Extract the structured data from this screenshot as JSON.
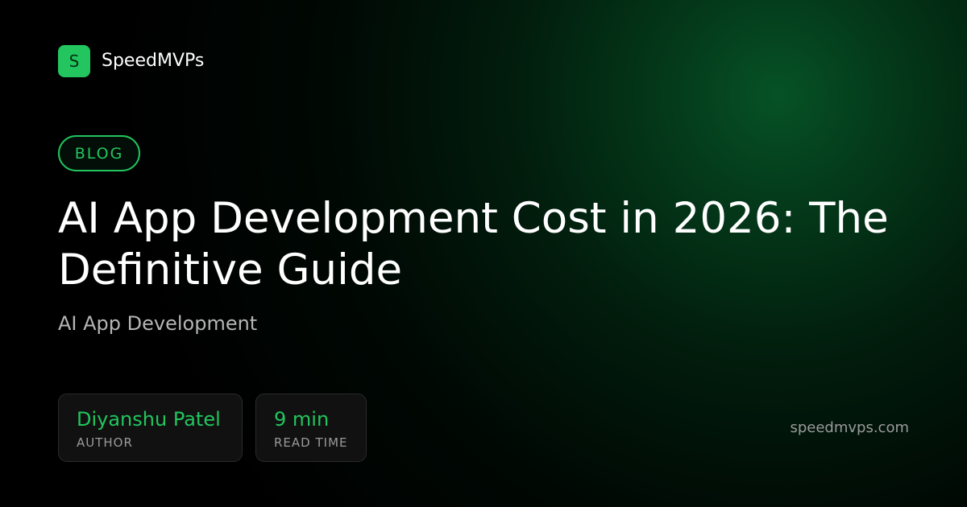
{
  "brand": {
    "logo_letter": "S",
    "name": "SpeedMVPs",
    "accent_color": "#22c55e"
  },
  "category": "BLOG",
  "title": "AI App Development Cost in 2026: The Definitive Guide",
  "subtitle": "AI App Development",
  "meta": {
    "author": {
      "value": "Diyanshu Patel",
      "label": "AUTHOR"
    },
    "read_time": {
      "value": "9 min",
      "label": "READ TIME"
    }
  },
  "site_url": "speedmvps.com"
}
